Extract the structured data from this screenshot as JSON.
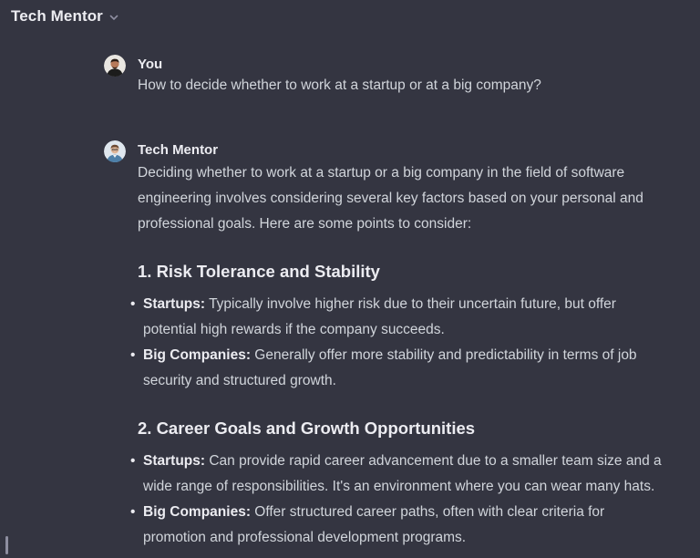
{
  "header": {
    "title": "Tech Mentor",
    "icon": "chevron-down-icon"
  },
  "messages": {
    "user": {
      "author": "You",
      "text": "How to decide whether to work at a startup or at a big company?"
    },
    "bot": {
      "author": "Tech Mentor",
      "intro": "Deciding whether to work at a startup or a big company in the field of software engineering involves considering several key factors based on your personal and professional goals. Here are some points to consider:",
      "sections": [
        {
          "heading": "1. Risk Tolerance and Stability",
          "points": [
            {
              "label": "Startups:",
              "text": " Typically involve higher risk due to their uncertain future, but offer potential high rewards if the company succeeds."
            },
            {
              "label": "Big Companies:",
              "text": " Generally offer more stability and predictability in terms of job security and structured growth."
            }
          ]
        },
        {
          "heading": "2. Career Goals and Growth Opportunities",
          "points": [
            {
              "label": "Startups:",
              "text": " Can provide rapid career advancement due to a smaller team size and a wide range of responsibilities. It's an environment where you can wear many hats."
            },
            {
              "label": "Big Companies:",
              "text": " Offer structured career paths, often with clear criteria for promotion and professional development programs."
            }
          ]
        }
      ]
    }
  },
  "colors": {
    "background": "#343541",
    "text": "#d1d5db",
    "heading": "#ececf1"
  }
}
